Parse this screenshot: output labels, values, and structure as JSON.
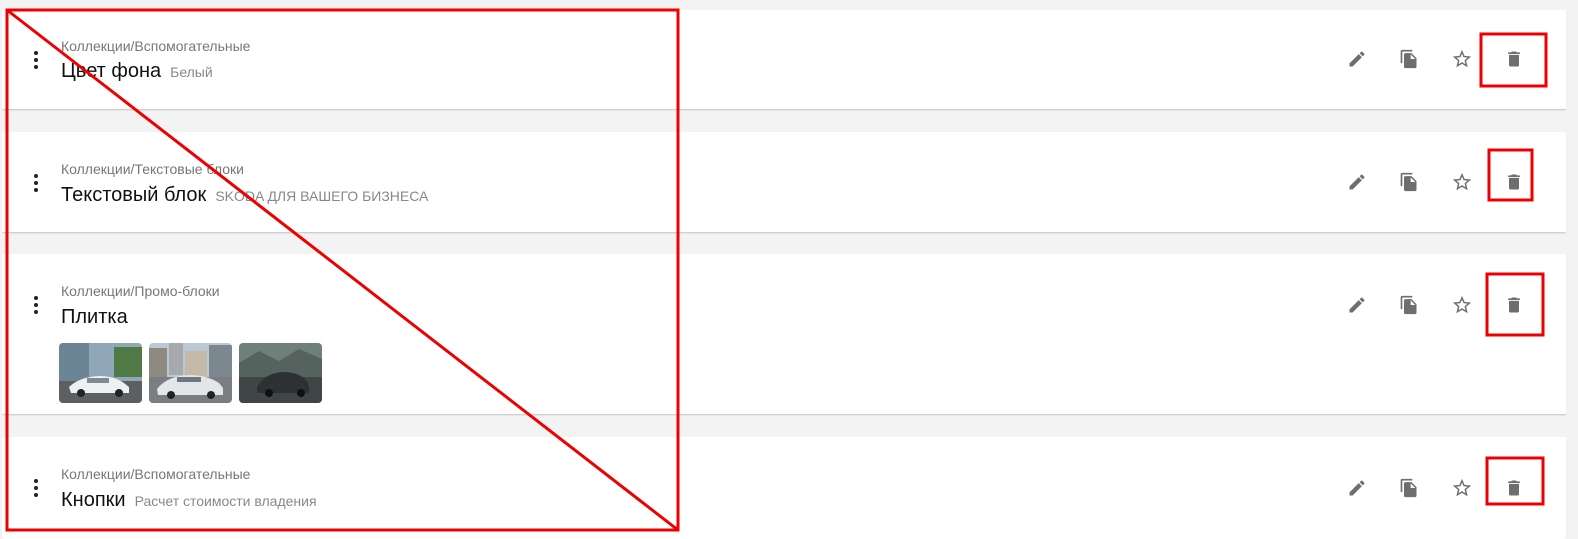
{
  "items": [
    {
      "path": "Коллекции/Вспомогательные",
      "title": "Цвет фона",
      "subtitle": "Белый"
    },
    {
      "path": "Коллекции/Текстовые блоки",
      "title": "Текстовый блок",
      "subtitle": "SKODA ДЛЯ ВАШЕГО БИЗНЕСА"
    },
    {
      "path": "Коллекции/Промо-блоки",
      "title": "Плитка",
      "subtitle": "",
      "thumbnails": [
        "car-photo-white-sedan-street",
        "car-photo-silver-sedan-city",
        "car-photo-dark-suv-mountains"
      ]
    },
    {
      "path": "Коллекции/Вспомогательные",
      "title": "Кнопки",
      "subtitle": "Расчет стоимости владения"
    }
  ],
  "actions": [
    "edit-icon",
    "copy-icon",
    "star-icon",
    "delete-icon"
  ],
  "colors": {
    "icon": "#6e6e6e",
    "annotation_red": "#ee0000",
    "background": "#f3f3f3",
    "card": "#ffffff"
  }
}
